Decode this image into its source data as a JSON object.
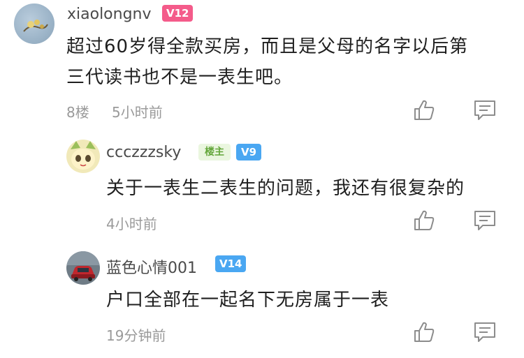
{
  "comments": [
    {
      "username": "xiaolongnv",
      "level": "V12",
      "level_color": "#f45b8a",
      "text_line1": "超过60岁得全款买房，而且是父母的名字以后第",
      "text_line2": "三代读书也不是一表生吧。",
      "floor": "8楼",
      "time": "5小时前"
    },
    {
      "username": "ccczzzsky",
      "host_badge": "楼主",
      "level": "V9",
      "level_color": "#4aa7f2",
      "text": "关于一表生二表生的问题，我还有很复杂的",
      "time": "4小时前"
    },
    {
      "username": "蓝色心情001",
      "level": "V14",
      "level_color": "#4aa7f2",
      "text": "户口全部在一起名下无房属于一表",
      "time": "19分钟前"
    }
  ],
  "icons": [
    "thumbs-up-icon",
    "comment-icon"
  ]
}
